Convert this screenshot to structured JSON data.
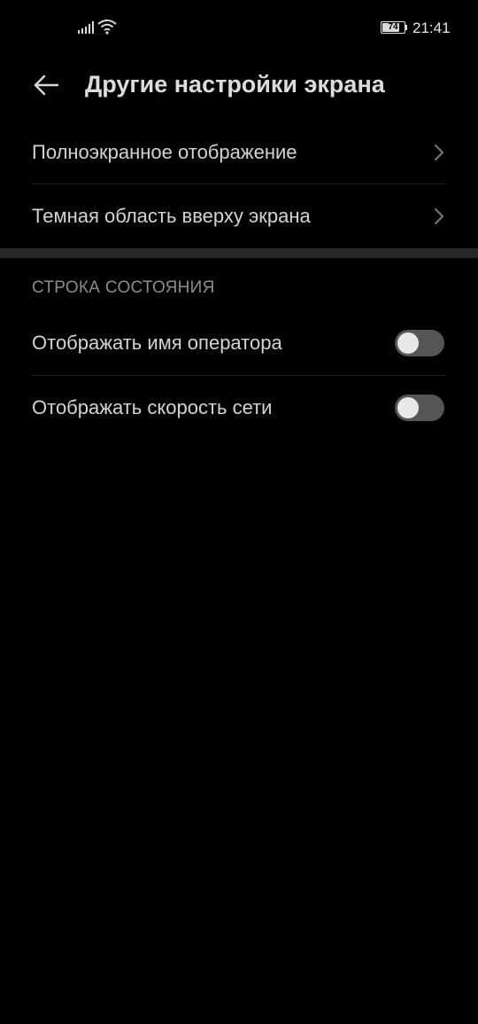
{
  "status_bar": {
    "battery_level": "74",
    "time": "21:41",
    "icons": [
      "signal-icon",
      "wifi-icon",
      "battery-icon"
    ]
  },
  "header": {
    "back_icon": "arrow-left-icon",
    "title": "Другие настройки экрана"
  },
  "items": [
    {
      "label": "Полноэкранное отображение",
      "type": "navigation",
      "icon": "chevron-right-icon"
    },
    {
      "label": "Темная область вверху экрана",
      "type": "navigation",
      "icon": "chevron-right-icon"
    }
  ],
  "status_section": {
    "header": "СТРОКА СОСТОЯНИЯ",
    "items": [
      {
        "label": "Отображать имя оператора",
        "type": "toggle",
        "checked": false
      },
      {
        "label": "Отображать скорость сети",
        "type": "toggle",
        "checked": false
      }
    ]
  },
  "colors": {
    "background": "#000000",
    "text": "#d3d3d3",
    "section_header": "#8c8c8c",
    "toggle_off_track": "#555555",
    "toggle_knob": "#e8e8e8",
    "separator": "#262626"
  }
}
